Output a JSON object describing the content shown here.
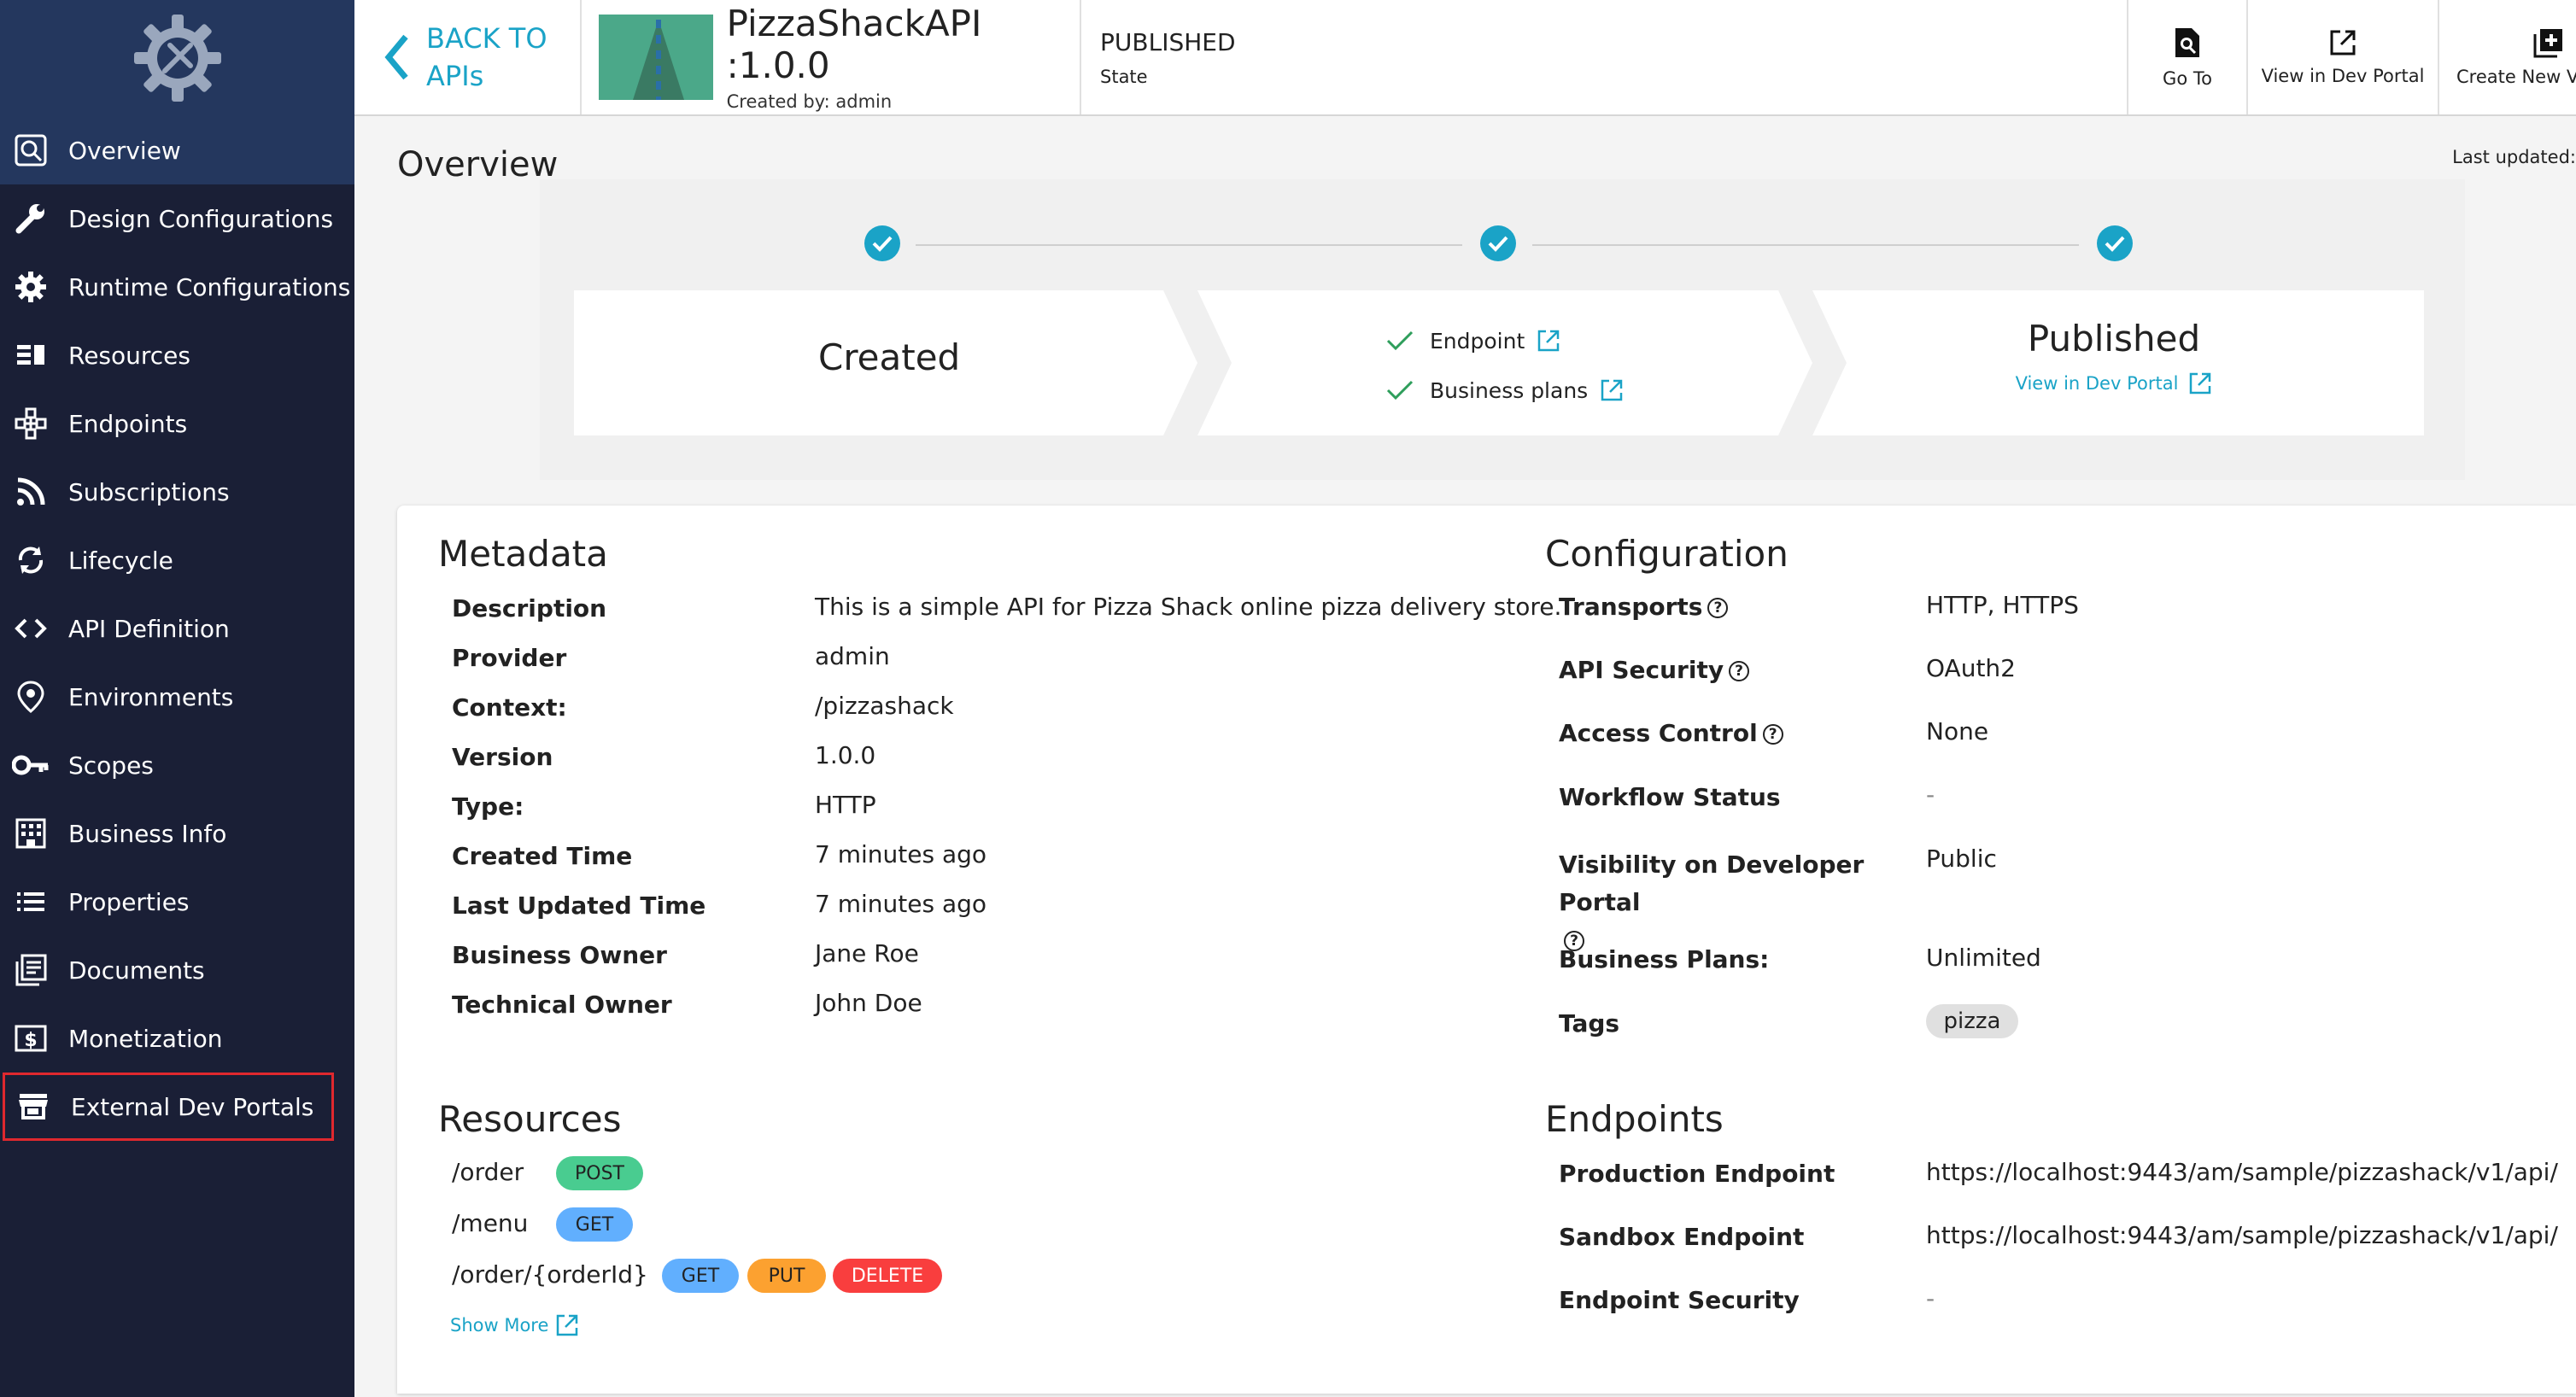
{
  "sidebar": {
    "items": [
      {
        "label": "Overview",
        "icon": "search-icon"
      },
      {
        "label": "Design Configurations",
        "icon": "wrench-icon"
      },
      {
        "label": "Runtime Configurations",
        "icon": "gear-icon"
      },
      {
        "label": "Resources",
        "icon": "list-icon"
      },
      {
        "label": "Endpoints",
        "icon": "network-icon"
      },
      {
        "label": "Subscriptions",
        "icon": "rss-icon"
      },
      {
        "label": "Lifecycle",
        "icon": "cycle-icon"
      },
      {
        "label": "API Definition",
        "icon": "code-icon"
      },
      {
        "label": "Environments",
        "icon": "location-icon"
      },
      {
        "label": "Scopes",
        "icon": "key-icon"
      },
      {
        "label": "Business Info",
        "icon": "building-icon"
      },
      {
        "label": "Properties",
        "icon": "properties-icon"
      },
      {
        "label": "Documents",
        "icon": "documents-icon"
      },
      {
        "label": "Monetization",
        "icon": "dollar-icon"
      },
      {
        "label": "External Dev Portals",
        "icon": "store-icon"
      }
    ]
  },
  "header": {
    "back_line1": "BACK TO",
    "back_line2": "APIs",
    "api_title": "PizzaShackAPI :1.0.0",
    "created_by": "Created by: admin",
    "state_value": "PUBLISHED",
    "state_label": "State",
    "goto_label": "Go To",
    "devportal_label": "View in Dev Portal",
    "newversion_label": "Create New Ve"
  },
  "overview": {
    "title": "Overview",
    "last_updated": "Last updated:"
  },
  "lifecycle": {
    "created": "Created",
    "endpoint": "Endpoint",
    "business_plans": "Business plans",
    "published": "Published",
    "view_devportal": "View in Dev Portal"
  },
  "metadata": {
    "title": "Metadata",
    "rows": [
      {
        "label": "Description",
        "value": "This is a simple API for Pizza Shack online pizza delivery store."
      },
      {
        "label": "Provider",
        "value": "admin"
      },
      {
        "label": "Context:",
        "value": "/pizzashack"
      },
      {
        "label": "Version",
        "value": "1.0.0"
      },
      {
        "label": "Type:",
        "value": "HTTP"
      },
      {
        "label": "Created Time",
        "value": "7 minutes ago"
      },
      {
        "label": "Last Updated Time",
        "value": "7 minutes ago"
      },
      {
        "label": "Business Owner",
        "value": "Jane Roe"
      },
      {
        "label": "Technical Owner",
        "value": "John Doe"
      }
    ]
  },
  "configuration": {
    "title": "Configuration",
    "rows": [
      {
        "label": "Transports",
        "value": "HTTP, HTTPS"
      },
      {
        "label": "API Security",
        "value": "OAuth2"
      },
      {
        "label": "Access Control",
        "value": "None"
      },
      {
        "label": "Workflow Status",
        "value": "-"
      },
      {
        "label": "Visibility on Developer Portal",
        "value": "Public"
      },
      {
        "label": "Business Plans:",
        "value": "Unlimited"
      },
      {
        "label": "Tags",
        "value": "pizza"
      }
    ]
  },
  "resources": {
    "title": "Resources",
    "items": [
      {
        "path": "/order",
        "methods": [
          "POST"
        ]
      },
      {
        "path": "/menu",
        "methods": [
          "GET"
        ]
      },
      {
        "path": "/order/{orderId}",
        "methods": [
          "GET",
          "PUT",
          "DELETE"
        ]
      }
    ],
    "show_more": "Show More"
  },
  "endpoints": {
    "title": "Endpoints",
    "rows": [
      {
        "label": "Production Endpoint",
        "value": "https://localhost:9443/am/sample/pizzashack/v1/api/"
      },
      {
        "label": "Sandbox Endpoint",
        "value": "https://localhost:9443/am/sample/pizzashack/v1/api/"
      },
      {
        "label": "Endpoint Security",
        "value": "-"
      }
    ]
  },
  "colors": {
    "accent": "#1aa3c7",
    "sidebar": "#1a1f36",
    "post": "#49cc90",
    "get": "#61affe",
    "put": "#fca130",
    "delete": "#f93e3e"
  }
}
